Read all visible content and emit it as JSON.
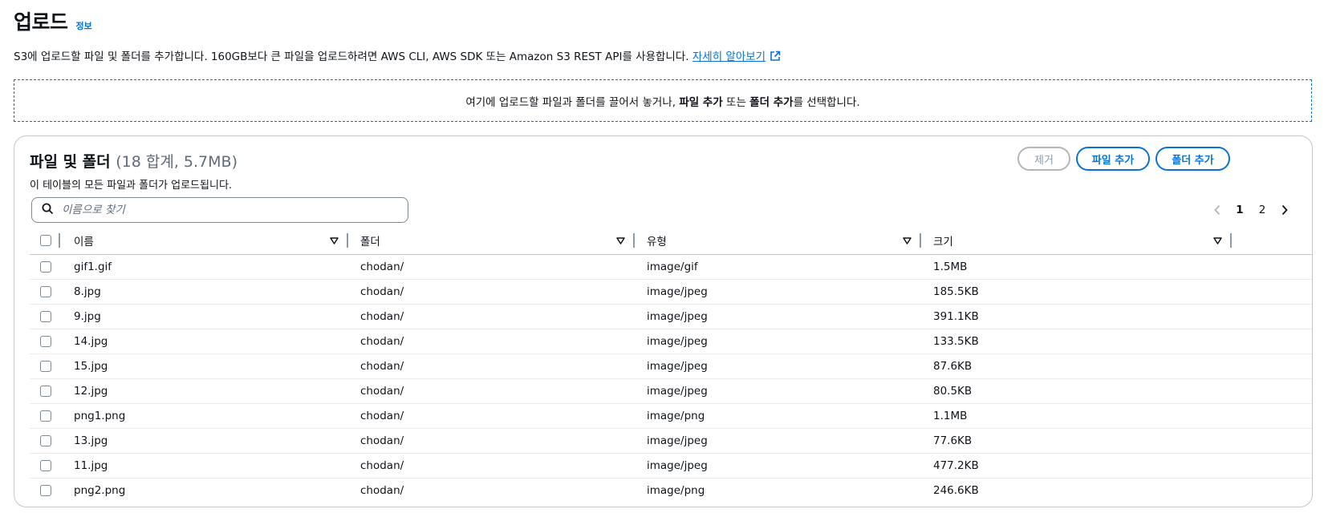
{
  "header": {
    "title": "업로드",
    "info_link": "정보"
  },
  "description": {
    "text": "S3에 업로드할 파일 및 폴더를 추가합니다. 160GB보다 큰 파일을 업로드하려면 AWS CLI, AWS SDK 또는 Amazon S3 REST API를 사용합니다.",
    "learn_more": "자세히 알아보기",
    "external_icon": "external-link-icon"
  },
  "dropzone": {
    "prefix": "여기에 업로드할 파일과 폴더를 끌어서 놓거나,",
    "add_files": "파일 추가",
    "or": "또는",
    "add_folder": "폴더 추가",
    "suffix": "를 선택합니다."
  },
  "files_panel": {
    "title": "파일 및 폴더",
    "count": "(18 합계, 5.7MB)",
    "description": "이 테이블의 모든 파일과 폴더가 업로드됩니다.",
    "remove_button": "제거",
    "add_files_button": "파일 추가",
    "add_folder_button": "폴더 추가",
    "search": {
      "placeholder": "이름으로 찾기",
      "icon": "search-icon"
    },
    "pagination": {
      "pages": [
        "1",
        "2"
      ],
      "current": "1"
    },
    "columns": [
      "이름",
      "폴더",
      "유형",
      "크기"
    ],
    "rows": [
      {
        "name": "gif1.gif",
        "folder": "chodan/",
        "type": "image/gif",
        "size": "1.5MB"
      },
      {
        "name": "8.jpg",
        "folder": "chodan/",
        "type": "image/jpeg",
        "size": "185.5KB"
      },
      {
        "name": "9.jpg",
        "folder": "chodan/",
        "type": "image/jpeg",
        "size": "391.1KB"
      },
      {
        "name": "14.jpg",
        "folder": "chodan/",
        "type": "image/jpeg",
        "size": "133.5KB"
      },
      {
        "name": "15.jpg",
        "folder": "chodan/",
        "type": "image/jpeg",
        "size": "87.6KB"
      },
      {
        "name": "12.jpg",
        "folder": "chodan/",
        "type": "image/jpeg",
        "size": "80.5KB"
      },
      {
        "name": "png1.png",
        "folder": "chodan/",
        "type": "image/png",
        "size": "1.1MB"
      },
      {
        "name": "13.jpg",
        "folder": "chodan/",
        "type": "image/jpeg",
        "size": "77.6KB"
      },
      {
        "name": "11.jpg",
        "folder": "chodan/",
        "type": "image/jpeg",
        "size": "477.2KB"
      },
      {
        "name": "png2.png",
        "folder": "chodan/",
        "type": "image/png",
        "size": "246.6KB"
      }
    ]
  },
  "colors": {
    "accent": "#0972d3",
    "text": "#0f141a",
    "muted": "#5f6b7a",
    "border": "#c6c6cd"
  }
}
